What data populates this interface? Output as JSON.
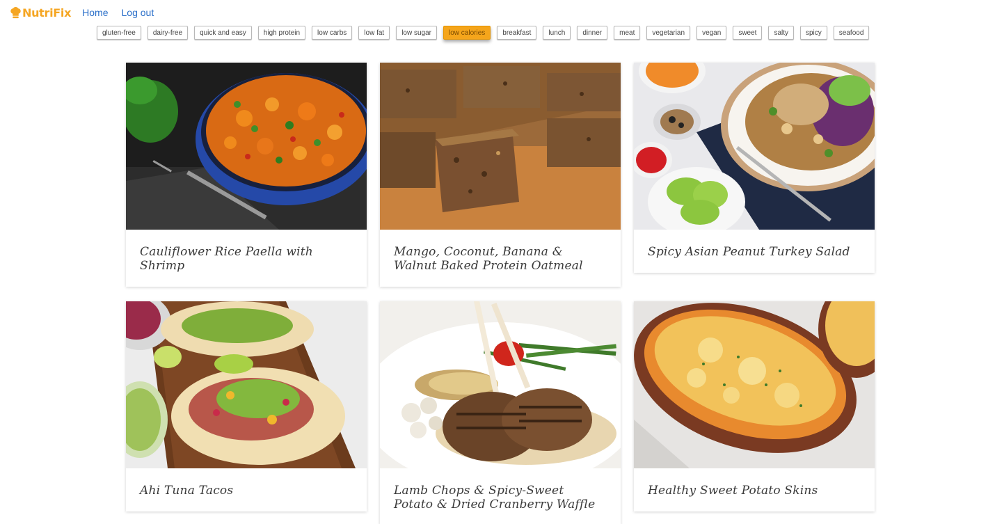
{
  "header": {
    "brand": "NutriFix",
    "nav": [
      {
        "label": "Home"
      },
      {
        "label": "Log out"
      }
    ]
  },
  "filters": {
    "tags": [
      {
        "label": "gluten-free",
        "active": false
      },
      {
        "label": "dairy-free",
        "active": false
      },
      {
        "label": "quick and easy",
        "active": false
      },
      {
        "label": "high protein",
        "active": false
      },
      {
        "label": "low carbs",
        "active": false
      },
      {
        "label": "low fat",
        "active": false
      },
      {
        "label": "low sugar",
        "active": false
      },
      {
        "label": "low calories",
        "active": true
      },
      {
        "label": "breakfast",
        "active": false
      },
      {
        "label": "lunch",
        "active": false
      },
      {
        "label": "dinner",
        "active": false
      },
      {
        "label": "meat",
        "active": false
      },
      {
        "label": "vegetarian",
        "active": false
      },
      {
        "label": "vegan",
        "active": false
      },
      {
        "label": "sweet",
        "active": false
      },
      {
        "label": "salty",
        "active": false
      },
      {
        "label": "spicy",
        "active": false
      },
      {
        "label": "seafood",
        "active": false
      }
    ]
  },
  "recipes": [
    {
      "title": "Cauliflower Rice Paella with Shrimp"
    },
    {
      "title": "Mango, Coconut, Banana & Walnut Baked Protein Oatmeal"
    },
    {
      "title": "Spicy Asian Peanut Turkey Salad"
    },
    {
      "title": "Ahi Tuna Tacos"
    },
    {
      "title": "Lamb Chops & Spicy-Sweet Potato & Dried Cranberry Waffle"
    },
    {
      "title": "Healthy Sweet Potato Skins"
    }
  ],
  "colors": {
    "brand": "#f5a623",
    "link": "#2a6fc9",
    "active_tag": "#f5a51b"
  }
}
